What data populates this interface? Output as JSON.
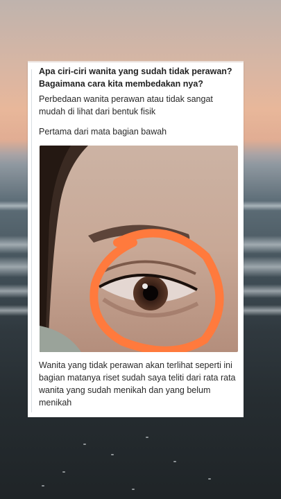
{
  "post": {
    "question": "Apa ciri-ciri wanita yang sudah tidak perawan? Bagaimana cara kita membedakan nya?",
    "intro": "Perbedaan wanita perawan atau tidak sangat mudah di lihat dari bentuk fisik",
    "first_point": "Pertama dari mata bagian bawah",
    "caption": "Wanita yang tidak perawan akan terlihat seperti ini bagian matanya riset sudah saya teliti dari rata rata wanita yang sudah menikah dan yang belum menikah"
  },
  "colors": {
    "highlight_circle": "#ff7a3d",
    "card_background": "#ffffff"
  },
  "icons": {
    "photo": "eye-photo-with-orange-circle"
  }
}
